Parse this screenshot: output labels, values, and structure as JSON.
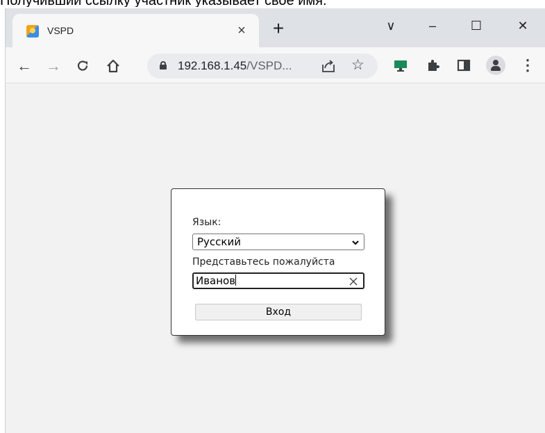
{
  "caption": "Получивший ссылку участник указывает своё имя.",
  "browser": {
    "tab_title": "VSPD",
    "tab_close": "×",
    "new_tab": "+",
    "url_host": "192.168.1.45",
    "url_rest": "/VSPD...",
    "window_controls": {
      "tabsearch": "∨",
      "minimize": "–",
      "maximize": "☐",
      "close": "✕"
    },
    "icons": [
      "back-arrow-icon",
      "forward-arrow-icon",
      "reload-icon",
      "home-icon",
      "lock-icon",
      "share-icon",
      "star-icon",
      "monitor-icon",
      "puzzle-icon",
      "side-panel-icon",
      "profile-avatar",
      "menu-icon"
    ]
  },
  "login": {
    "language_label": "Язык:",
    "language_value": "Русский",
    "name_label": "Представьтесь пожалуйста",
    "name_value": "Иванов",
    "submit_label": "Вход"
  }
}
